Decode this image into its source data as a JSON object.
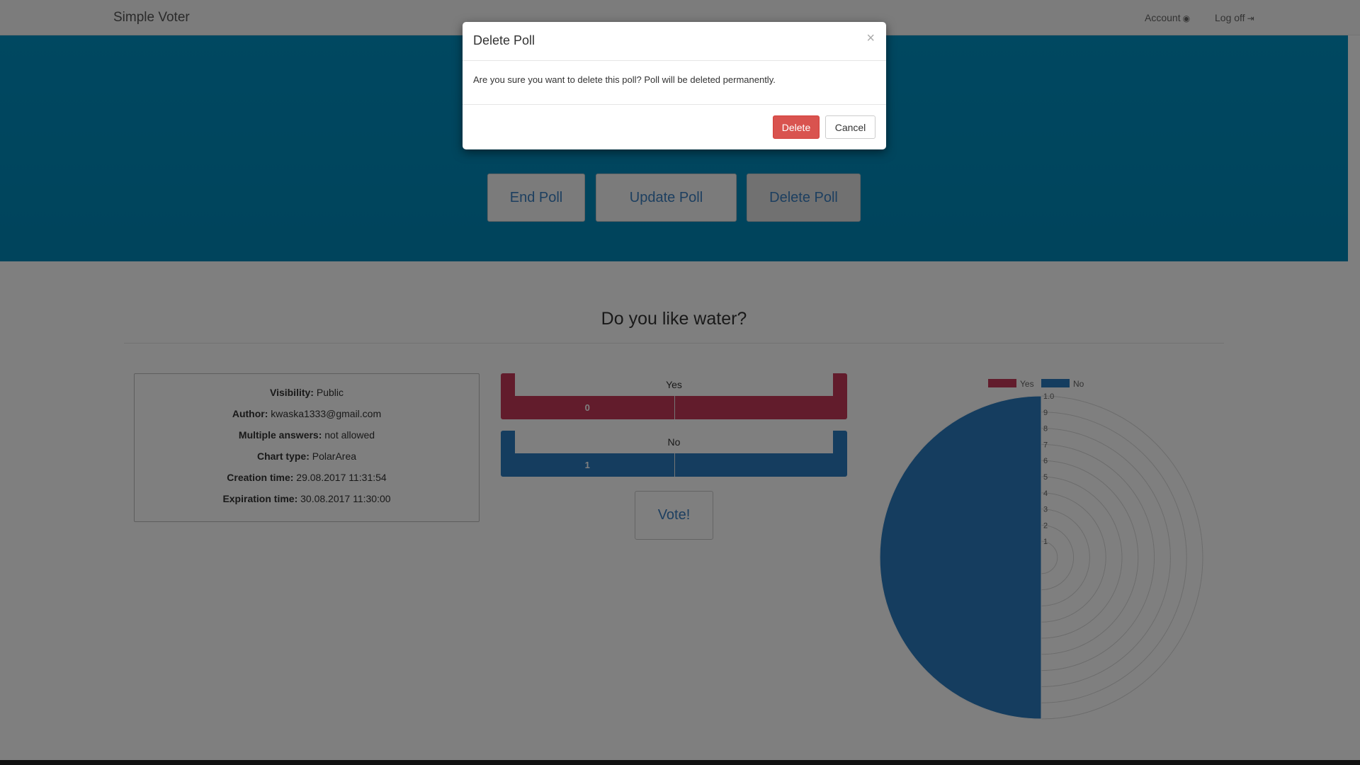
{
  "navbar": {
    "brand": "Simple Voter",
    "account_label": "Account",
    "account_icon": "user-circle-icon",
    "logoff_label": "Log off",
    "logoff_icon": "sign-out-icon"
  },
  "hero": {
    "buttons": [
      "End Poll",
      "Update Poll",
      "Delete Poll"
    ]
  },
  "poll": {
    "question": "Do you like water?",
    "info": [
      {
        "label": "Visibility:",
        "value": "Public"
      },
      {
        "label": "Author:",
        "value": "kwaska1333@gmail.com"
      },
      {
        "label": "Multiple answers:",
        "value": "not allowed"
      },
      {
        "label": "Chart type:",
        "value": "PolarArea"
      },
      {
        "label": "Creation time:",
        "value": "29.08.2017 11:31:54"
      },
      {
        "label": "Expiration time:",
        "value": "30.08.2017 11:30:00"
      }
    ],
    "answers": [
      {
        "label": "Yes",
        "count": "0"
      },
      {
        "label": "No",
        "count": "1"
      }
    ],
    "vote_label": "Vote!"
  },
  "colors": {
    "yes": "#c43858",
    "no": "#2a7bbf",
    "hero": "#0088b8",
    "danger": "#d9534f"
  },
  "chart_data": {
    "type": "polarArea",
    "categories": [
      "Yes",
      "No"
    ],
    "values": [
      0,
      1
    ],
    "colors": [
      "#c43858",
      "#2a7bbf"
    ],
    "r_range": [
      0,
      1
    ],
    "r_ticks": [
      "1",
      "2",
      "3",
      "4",
      "5",
      "6",
      "7",
      "8",
      "9",
      "1.0"
    ],
    "legend": "top",
    "grid": true
  },
  "modal": {
    "title": "Delete Poll",
    "close_symbol": "×",
    "message": "Are you sure you want to delete this poll? Poll will be deleted permanently.",
    "delete_label": "Delete",
    "cancel_label": "Cancel"
  }
}
